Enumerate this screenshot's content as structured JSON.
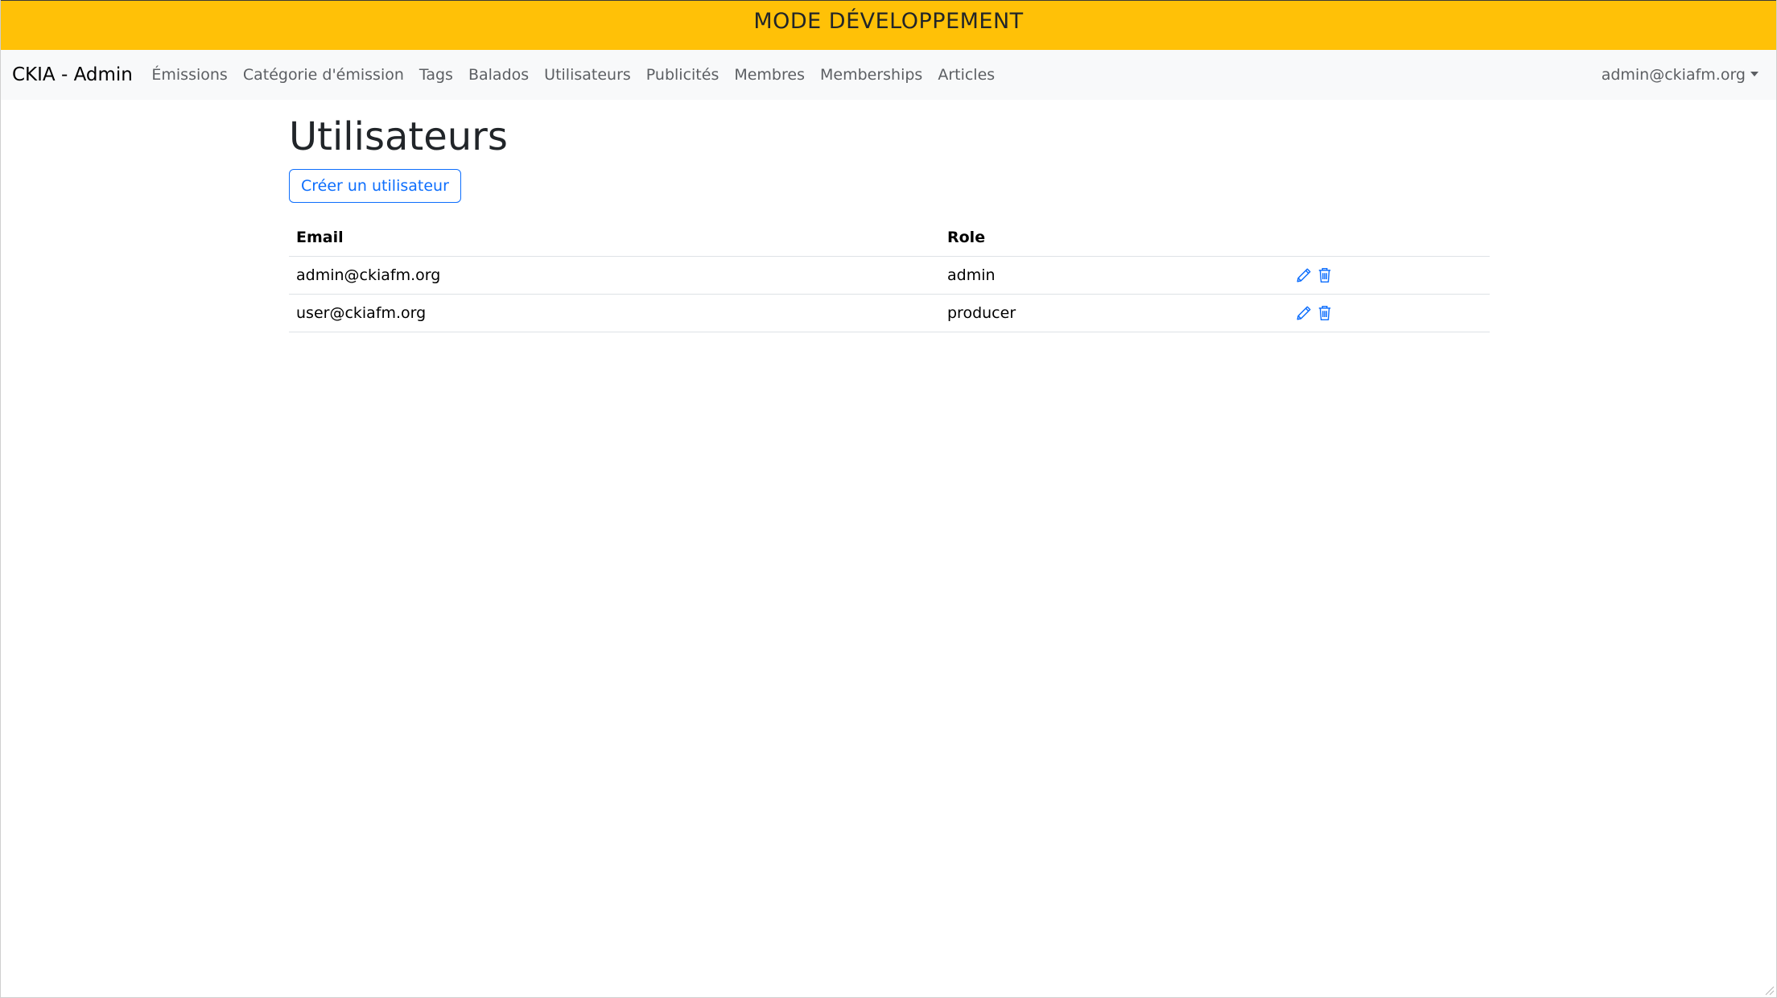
{
  "banner": {
    "text": "MODE DÉVELOPPEMENT"
  },
  "navbar": {
    "brand": "CKIA - Admin",
    "links": [
      {
        "label": "Émissions"
      },
      {
        "label": "Catégorie d'émission"
      },
      {
        "label": "Tags"
      },
      {
        "label": "Balados"
      },
      {
        "label": "Utilisateurs"
      },
      {
        "label": "Publicités"
      },
      {
        "label": "Membres"
      },
      {
        "label": "Memberships"
      },
      {
        "label": "Articles"
      }
    ],
    "user_menu": "admin@ckiafm.org"
  },
  "main": {
    "title": "Utilisateurs",
    "create_button": "Créer un utilisateur",
    "table": {
      "headers": {
        "email": "Email",
        "role": "Role"
      },
      "rows": [
        {
          "email": "admin@ckiafm.org",
          "role": "admin"
        },
        {
          "email": "user@ckiafm.org",
          "role": "producer"
        }
      ]
    }
  },
  "icons": {
    "edit": "pencil-icon",
    "delete": "trash-icon",
    "user_menu": "caret-down-icon"
  },
  "colors": {
    "banner_bg": "#ffc107",
    "primary": "#0d6efd",
    "navbar_bg": "#f8f9fa"
  }
}
